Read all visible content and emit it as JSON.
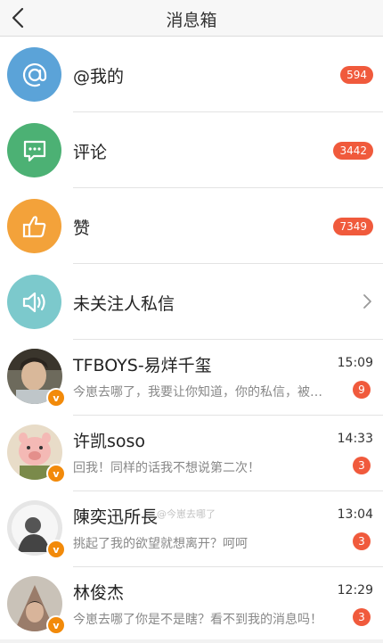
{
  "header": {
    "title": "消息箱"
  },
  "categories": [
    {
      "label": "@我的",
      "count": "594",
      "icon": "at-icon",
      "color": "#5ba3d8"
    },
    {
      "label": "评论",
      "count": "3442",
      "icon": "comment-icon",
      "color": "#4cb174"
    },
    {
      "label": "赞",
      "count": "7349",
      "icon": "thumbs-up-icon",
      "color": "#f3a23a"
    },
    {
      "label": "未关注人私信",
      "icon": "speaker-icon",
      "color": "#7cc9cc"
    }
  ],
  "conversations": [
    {
      "name": "TFBOYS-易烊千玺",
      "time": "15:09",
      "preview": "今崽去哪了，我要让你知道，你的私信，被…",
      "unread": "9",
      "verified": "v"
    },
    {
      "name": "许凯soso",
      "time": "14:33",
      "preview": "回我！同样的话我不想说第二次！",
      "unread": "3",
      "verified": "v"
    },
    {
      "name": "陳奕迅所長",
      "time": "13:04",
      "preview": "挑起了我的欲望就想离开？呵呵",
      "unread": "3",
      "verified": "v"
    },
    {
      "name": "林俊杰",
      "time": "12:29",
      "preview": "今崽去哪了你是不是瞎？看不到我的消息吗！",
      "unread": "3",
      "verified": "v"
    }
  ],
  "watermark": "@今崽去哪了"
}
